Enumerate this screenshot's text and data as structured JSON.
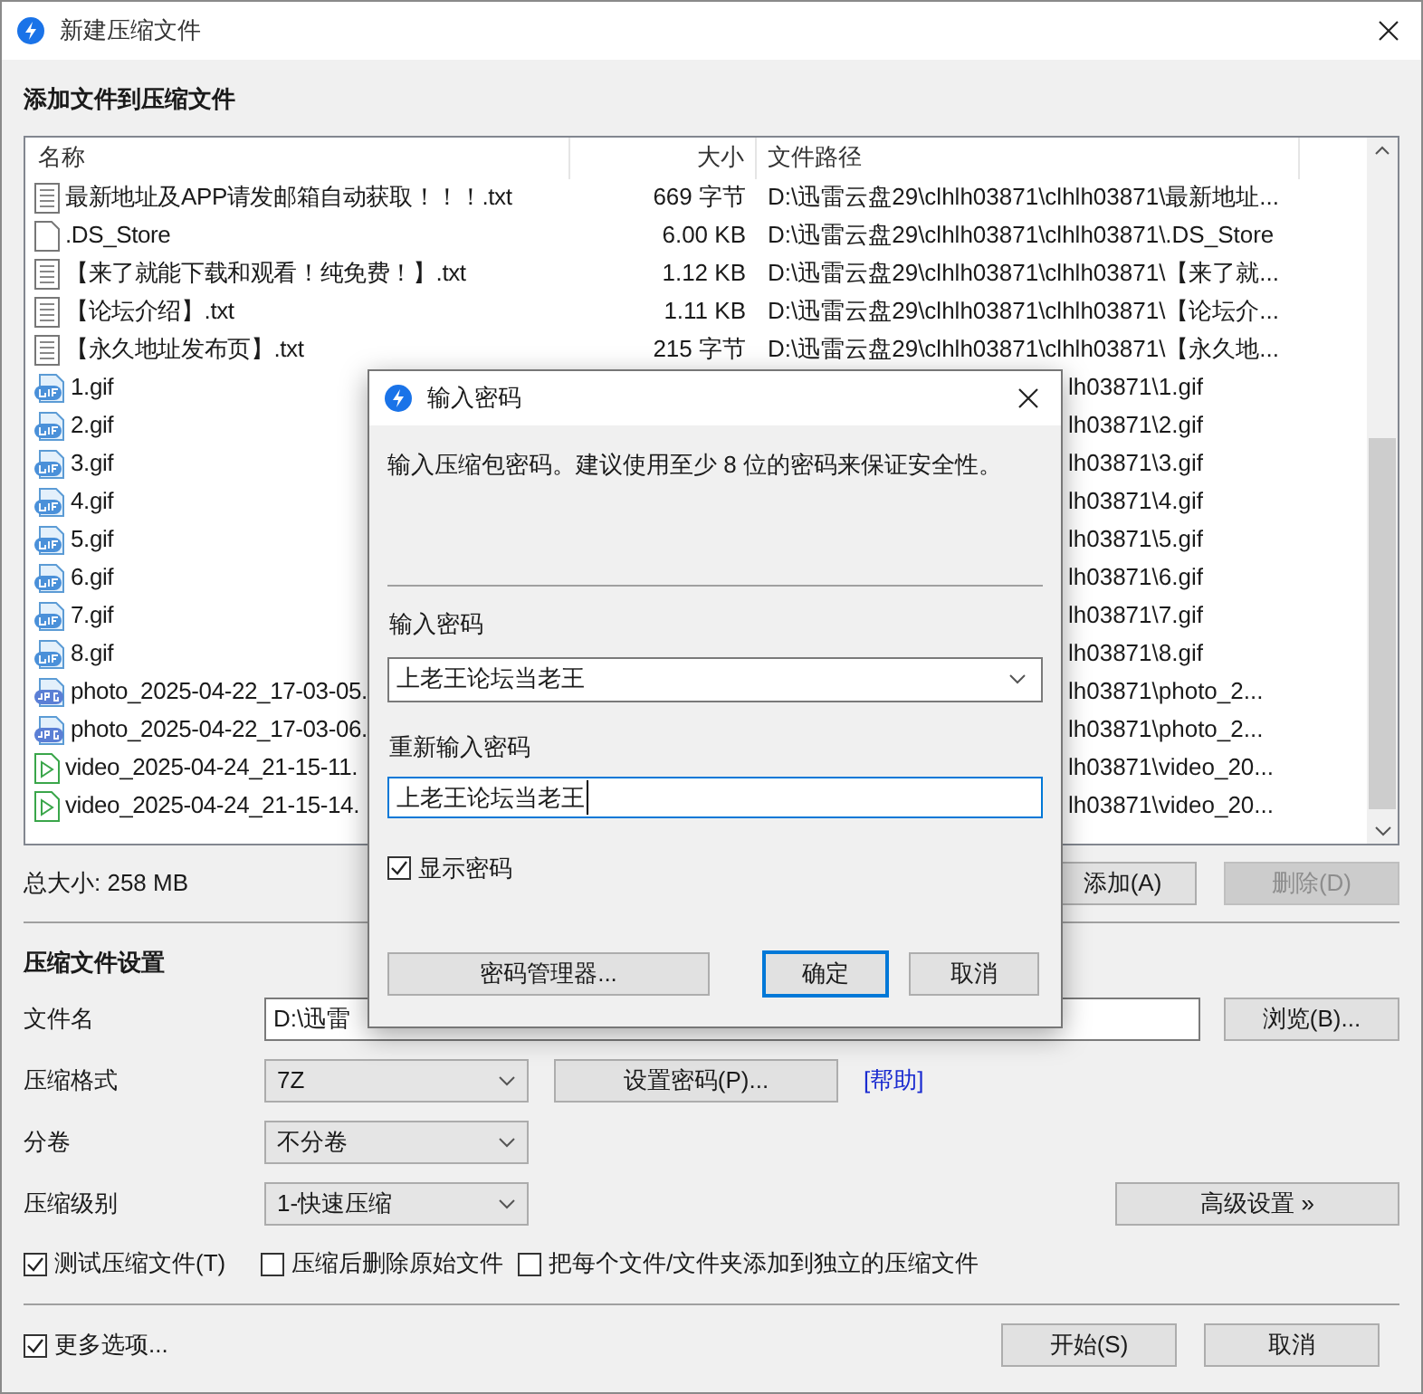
{
  "window": {
    "title": "新建压缩文件"
  },
  "files": {
    "title": "添加文件到压缩文件",
    "columns": [
      "名称",
      "大小",
      "文件路径"
    ],
    "rows": [
      {
        "kind": "text",
        "name": "最新地址及APP请发邮箱自动获取！！！.txt",
        "size": "669 字节",
        "path": "D:\\迅雷云盘29\\clhlh03871\\clhlh03871\\最新地址..."
      },
      {
        "kind": "blank",
        "name": ".DS_Store",
        "size": "6.00 KB",
        "path": "D:\\迅雷云盘29\\clhlh03871\\clhlh03871\\.DS_Store"
      },
      {
        "kind": "text",
        "name": "【来了就能下载和观看！纯免费！】.txt",
        "size": "1.12 KB",
        "path": "D:\\迅雷云盘29\\clhlh03871\\clhlh03871\\【来了就..."
      },
      {
        "kind": "text",
        "name": "【论坛介绍】.txt",
        "size": "1.11 KB",
        "path": "D:\\迅雷云盘29\\clhlh03871\\clhlh03871\\【论坛介..."
      },
      {
        "kind": "text",
        "name": "【永久地址发布页】.txt",
        "size": "215 字节",
        "path": "D:\\迅雷云盘29\\clhlh03871\\clhlh03871\\【永久地..."
      },
      {
        "kind": "gif",
        "name": "1.gif",
        "path": "lh03871\\1.gif"
      },
      {
        "kind": "gif",
        "name": "2.gif",
        "path": "lh03871\\2.gif"
      },
      {
        "kind": "gif",
        "name": "3.gif",
        "path": "lh03871\\3.gif"
      },
      {
        "kind": "gif",
        "name": "4.gif",
        "path": "lh03871\\4.gif"
      },
      {
        "kind": "gif",
        "name": "5.gif",
        "path": "lh03871\\5.gif"
      },
      {
        "kind": "gif",
        "name": "6.gif",
        "path": "lh03871\\6.gif"
      },
      {
        "kind": "gif",
        "name": "7.gif",
        "path": "lh03871\\7.gif"
      },
      {
        "kind": "gif",
        "name": "8.gif",
        "path": "lh03871\\8.gif"
      },
      {
        "kind": "jpg",
        "name": "photo_2025-04-22_17-03-05.",
        "path": "lh03871\\photo_2..."
      },
      {
        "kind": "jpg",
        "name": "photo_2025-04-22_17-03-06.",
        "path": "lh03871\\photo_2..."
      },
      {
        "kind": "video",
        "name": "video_2025-04-24_21-15-11.",
        "path": "lh03871\\video_20..."
      },
      {
        "kind": "video",
        "name": "video_2025-04-24_21-15-14.",
        "path": "lh03871\\video_20..."
      }
    ],
    "total": "总大小: 258 MB",
    "buttons": [
      {
        "label": "添加(A)",
        "disabled": false
      },
      {
        "label": "删除(D)",
        "disabled": true
      }
    ]
  },
  "settings": {
    "title": "压缩文件设置",
    "file_name": {
      "label": "文件名",
      "value": "D:\\迅雷",
      "button": "浏览(B)..."
    },
    "format": {
      "label": "压缩格式",
      "value": "7Z",
      "button": "设置密码(P)...",
      "link": "[帮助]"
    },
    "split": {
      "label": "分卷",
      "value": "不分卷"
    },
    "level": {
      "label": "压缩级别",
      "value": "1-快速压缩",
      "button": "高级设置 »"
    },
    "options": [
      {
        "label": "测试压缩文件(T)",
        "checked": true
      },
      {
        "label": "压缩后删除原始文件",
        "checked": false
      },
      {
        "label": "把每个文件/文件夹添加到独立的压缩文件",
        "checked": false
      }
    ]
  },
  "footer": {
    "more_options": {
      "label": "更多选项...",
      "checked": true
    },
    "buttons": [
      {
        "label": "开始(S)",
        "default": false
      },
      {
        "label": "取消",
        "default": false
      }
    ]
  },
  "dialog": {
    "title": "输入密码",
    "description": "输入压缩包密码。建议使用至少 8 位的密码来保证安全性。",
    "password_label": "输入密码",
    "password": "上老王论坛当老王",
    "confirm_label": "重新输入密码",
    "confirm": "上老王论坛当老王",
    "show_password": {
      "label": "显示密码",
      "checked": true
    },
    "buttons": [
      {
        "label": "密码管理器...",
        "default": false
      },
      {
        "label": "确定",
        "default": true
      },
      {
        "label": "取消",
        "default": false
      }
    ]
  }
}
